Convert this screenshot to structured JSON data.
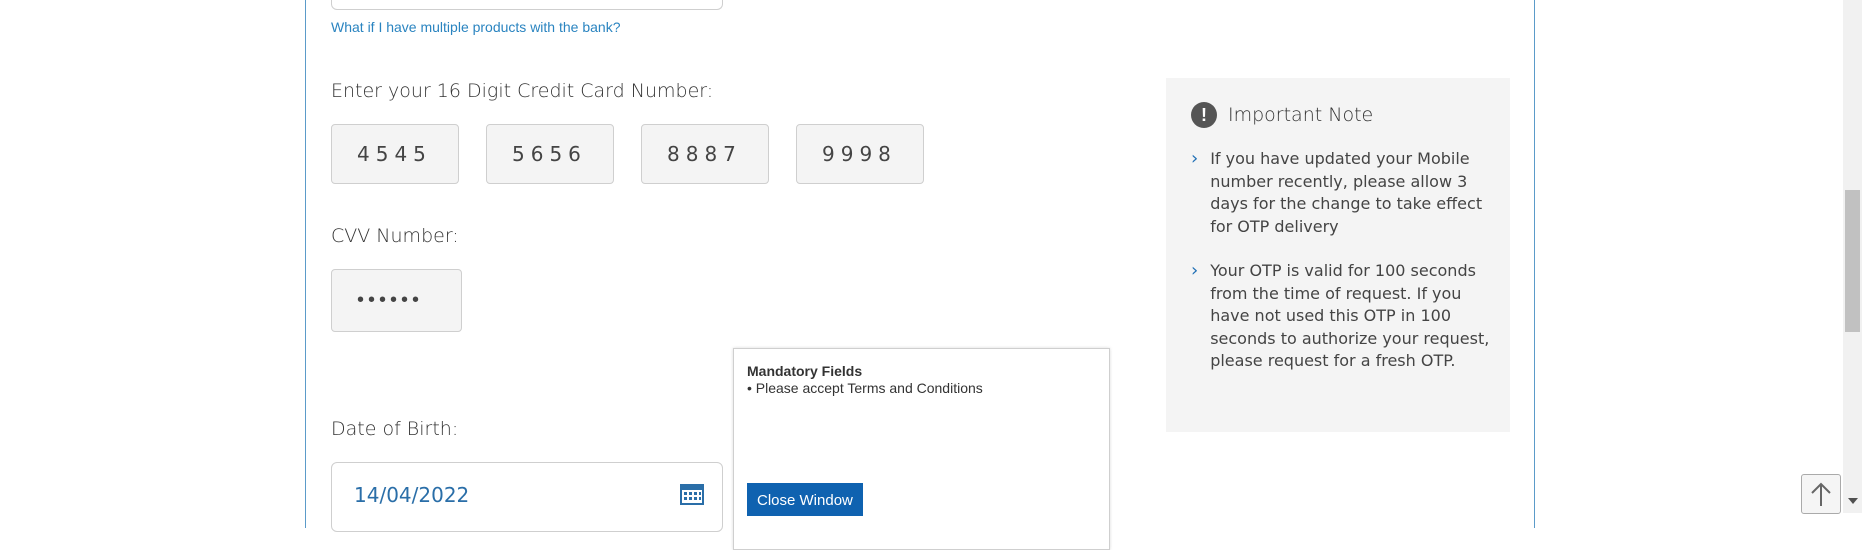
{
  "form": {
    "help_link": "What if I have multiple products with the bank?",
    "cc_label": "Enter your 16 Digit Credit Card Number:",
    "cc_groups": [
      "4545",
      "5656",
      "8887",
      "9998"
    ],
    "cvv_label": "CVV Number:",
    "cvv_value": "••••••",
    "dob_label": "Date of Birth:",
    "dob_value": "14/04/2022"
  },
  "note": {
    "icon": "!",
    "title": "Important Note",
    "items": [
      "If you have updated your Mobile number recently, please allow 3 days for the change to take effect for OTP delivery",
      "Your OTP is valid for 100 seconds from the time of request. If you have not used this OTP in 100 seconds to authorize your request, please request for a fresh OTP."
    ]
  },
  "popup": {
    "title": "Mandatory Fields",
    "message": "• Please accept Terms and Conditions",
    "close_label": "Close Window"
  },
  "colors": {
    "accent": "#2a84c0",
    "button": "#0f62b0",
    "panel_bg": "#f4f4f4"
  }
}
